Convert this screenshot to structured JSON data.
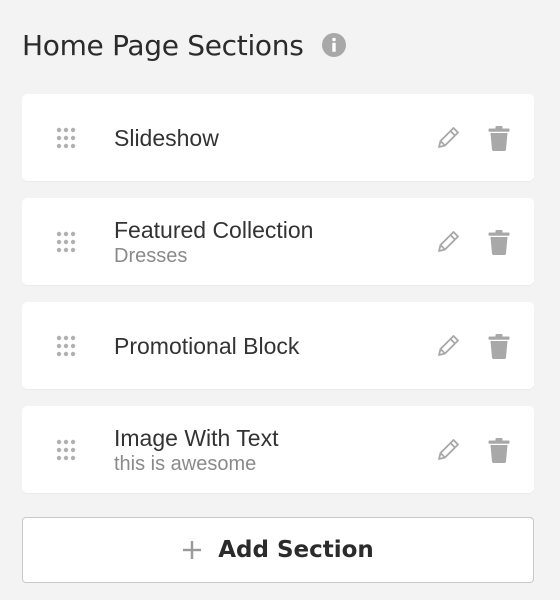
{
  "header": {
    "title": "Home Page Sections",
    "info_icon": "info-icon"
  },
  "colors": {
    "background": "#f3f3f3",
    "card": "#ffffff",
    "icon_gray": "#a8a8a8",
    "title_text": "#333333",
    "subtitle_text": "#8a8a8a"
  },
  "sections": [
    {
      "title": "Slideshow",
      "subtitle": ""
    },
    {
      "title": "Featured Collection",
      "subtitle": "Dresses"
    },
    {
      "title": "Promotional Block",
      "subtitle": ""
    },
    {
      "title": "Image With Text",
      "subtitle": "this is awesome"
    }
  ],
  "section_icons": {
    "drag": "drag-handle-icon",
    "edit": "pencil-icon",
    "delete": "trash-icon"
  },
  "add_section": {
    "label": "Add Section",
    "icon": "plus-icon"
  }
}
